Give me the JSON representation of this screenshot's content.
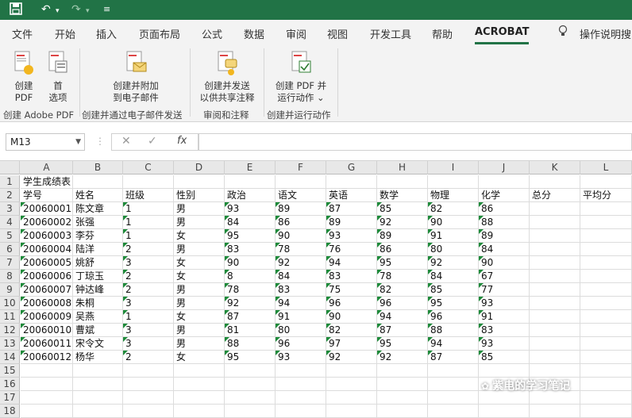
{
  "quick_access": {
    "save_icon": "save-icon",
    "undo_icon": "undo-icon",
    "redo_icon": "redo-icon",
    "customize_icon": "customize-icon"
  },
  "tabs": [
    "文件",
    "开始",
    "插入",
    "页面布局",
    "公式",
    "数据",
    "审阅",
    "视图",
    "开发工具",
    "帮助",
    "ACROBAT"
  ],
  "active_tab": "ACROBAT",
  "tell_me": "操作说明搜",
  "ribbon": {
    "groups": [
      {
        "label": "创建 Adobe PDF",
        "buttons": [
          "创建\nPDF",
          "首\n选项"
        ]
      },
      {
        "label": "创建并通过电子邮件发送",
        "buttons": [
          "创建并附加\n到电子邮件"
        ]
      },
      {
        "label": "审阅和注释",
        "buttons": [
          "创建并发送\n以供共享注释"
        ]
      },
      {
        "label": "创建并运行动作",
        "buttons": [
          "创建 PDF 并\n运行动作 ⌄"
        ]
      }
    ]
  },
  "namebox": "M13",
  "formula_icons": {
    "cancel": "✕",
    "enter": "✓",
    "fx": "fx"
  },
  "columns": [
    "A",
    "B",
    "C",
    "D",
    "E",
    "F",
    "G",
    "H",
    "I",
    "J",
    "K",
    "L"
  ],
  "rows": [
    [
      "学生成绩表",
      "",
      "",
      "",
      "",
      "",
      "",
      "",
      "",
      "",
      "",
      ""
    ],
    [
      "学号",
      "姓名",
      "班级",
      "性别",
      "政治",
      "语文",
      "英语",
      "数学",
      "物理",
      "化学",
      "总分",
      "平均分"
    ],
    [
      "20060001",
      "陈文章",
      "1",
      "男",
      "93",
      "89",
      "87",
      "85",
      "82",
      "86",
      "",
      ""
    ],
    [
      "20060002",
      "张强",
      "1",
      "男",
      "84",
      "86",
      "89",
      "92",
      "90",
      "88",
      "",
      ""
    ],
    [
      "20060003",
      "李芬",
      "1",
      "女",
      "95",
      "90",
      "93",
      "89",
      "91",
      "89",
      "",
      ""
    ],
    [
      "20060004",
      "陆洋",
      "2",
      "男",
      "83",
      "78",
      "76",
      "86",
      "80",
      "84",
      "",
      ""
    ],
    [
      "20060005",
      "姚舒",
      "3",
      "女",
      "90",
      "92",
      "94",
      "95",
      "92",
      "90",
      "",
      ""
    ],
    [
      "20060006",
      "丁琼玉",
      "2",
      "女",
      "8",
      "84",
      "83",
      "78",
      "84",
      "67",
      "",
      ""
    ],
    [
      "20060007",
      "钟达峰",
      "2",
      "男",
      "78",
      "83",
      "75",
      "82",
      "85",
      "77",
      "",
      ""
    ],
    [
      "20060008",
      "朱桐",
      "3",
      "男",
      "92",
      "94",
      "96",
      "96",
      "95",
      "93",
      "",
      ""
    ],
    [
      "20060009",
      "吴燕",
      "1",
      "女",
      "87",
      "91",
      "90",
      "94",
      "96",
      "91",
      "",
      ""
    ],
    [
      "20060010",
      "曹斌",
      "3",
      "男",
      "81",
      "80",
      "82",
      "87",
      "88",
      "83",
      "",
      ""
    ],
    [
      "20060011",
      "宋令文",
      "3",
      "男",
      "88",
      "96",
      "97",
      "95",
      "94",
      "93",
      "",
      ""
    ],
    [
      "20060012",
      "杨华",
      "2",
      "女",
      "95",
      "93",
      "92",
      "92",
      "87",
      "85",
      "",
      ""
    ],
    [
      "",
      "",
      "",
      "",
      "",
      "",
      "",
      "",
      "",
      "",
      "",
      ""
    ],
    [
      "",
      "",
      "",
      "",
      "",
      "",
      "",
      "",
      "",
      "",
      "",
      ""
    ],
    [
      "",
      "",
      "",
      "",
      "",
      "",
      "",
      "",
      "",
      "",
      "",
      ""
    ],
    [
      "",
      "",
      "",
      "",
      "",
      "",
      "",
      "",
      "",
      "",
      "",
      ""
    ]
  ],
  "row_numbers": [
    "1",
    "2",
    "3",
    "4",
    "5",
    "6",
    "7",
    "8",
    "9",
    "10",
    "11",
    "12",
    "13",
    "14",
    "15",
    "16",
    "17",
    "18"
  ],
  "watermark": "紫电的学习笔记"
}
